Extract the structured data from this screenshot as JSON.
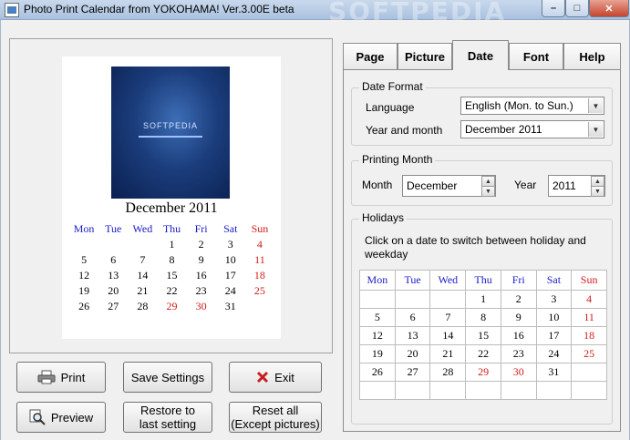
{
  "window": {
    "title": "Photo Print Calendar from YOKOHAMA! Ver.3.00E beta",
    "watermark": "SOFTPEDIA",
    "minimize_glyph": "–",
    "maximize_glyph": "□",
    "close_glyph": "✕"
  },
  "preview": {
    "photo_text": "SOFTPEDIA",
    "month_title": "December 2011",
    "weekdays": [
      "Mon",
      "Tue",
      "Wed",
      "Thu",
      "Fri",
      "Sat",
      "Sun"
    ],
    "weeks": [
      [
        "",
        "",
        "",
        "1",
        "2",
        "3",
        "4"
      ],
      [
        "5",
        "6",
        "7",
        "8",
        "9",
        "10",
        "11"
      ],
      [
        "12",
        "13",
        "14",
        "15",
        "16",
        "17",
        "18"
      ],
      [
        "19",
        "20",
        "21",
        "22",
        "23",
        "24",
        "25"
      ],
      [
        "26",
        "27",
        "28",
        "29",
        "30",
        "31",
        ""
      ]
    ],
    "red_days": [
      "4",
      "11",
      "18",
      "25",
      "29",
      "30"
    ]
  },
  "buttons": {
    "print": "Print",
    "preview": "Preview",
    "save_settings": "Save Settings",
    "restore_line1": "Restore to",
    "restore_line2": "last setting",
    "exit": "Exit",
    "reset_line1": "Reset all",
    "reset_line2": "(Except pictures)"
  },
  "tabs": {
    "page": "Page",
    "picture": "Picture",
    "date": "Date",
    "font": "Font",
    "help": "Help",
    "active": "Date"
  },
  "date_format": {
    "group_title": "Date Format",
    "language_label": "Language",
    "language_value": "English (Mon. to Sun.)",
    "year_month_label": "Year and month",
    "year_month_value": "December 2011"
  },
  "printing_month": {
    "group_title": "Printing Month",
    "month_label": "Month",
    "month_value": "December",
    "year_label": "Year",
    "year_value": "2011"
  },
  "holidays": {
    "group_title": "Holidays",
    "hint": "Click on a date to switch between holiday and weekday",
    "weekdays": [
      "Mon",
      "Tue",
      "Wed",
      "Thu",
      "Fri",
      "Sat",
      "Sun"
    ],
    "weeks": [
      [
        "",
        "",
        "",
        "1",
        "2",
        "3",
        "4"
      ],
      [
        "5",
        "6",
        "7",
        "8",
        "9",
        "10",
        "11"
      ],
      [
        "12",
        "13",
        "14",
        "15",
        "16",
        "17",
        "18"
      ],
      [
        "19",
        "20",
        "21",
        "22",
        "23",
        "24",
        "25"
      ],
      [
        "26",
        "27",
        "28",
        "29",
        "30",
        "31",
        ""
      ],
      [
        "",
        "",
        "",
        "",
        "",
        "",
        ""
      ]
    ],
    "red_days": [
      "4",
      "11",
      "18",
      "25",
      "29",
      "30"
    ]
  },
  "colors": {
    "weekday_header": "#1a1ac8",
    "holiday": "#d21a1a",
    "exit_icon": "#c81e1e"
  },
  "icons": {
    "app": "calendar-app-icon",
    "print": "printer-icon",
    "preview": "magnifier-icon",
    "exit": "x-icon"
  }
}
